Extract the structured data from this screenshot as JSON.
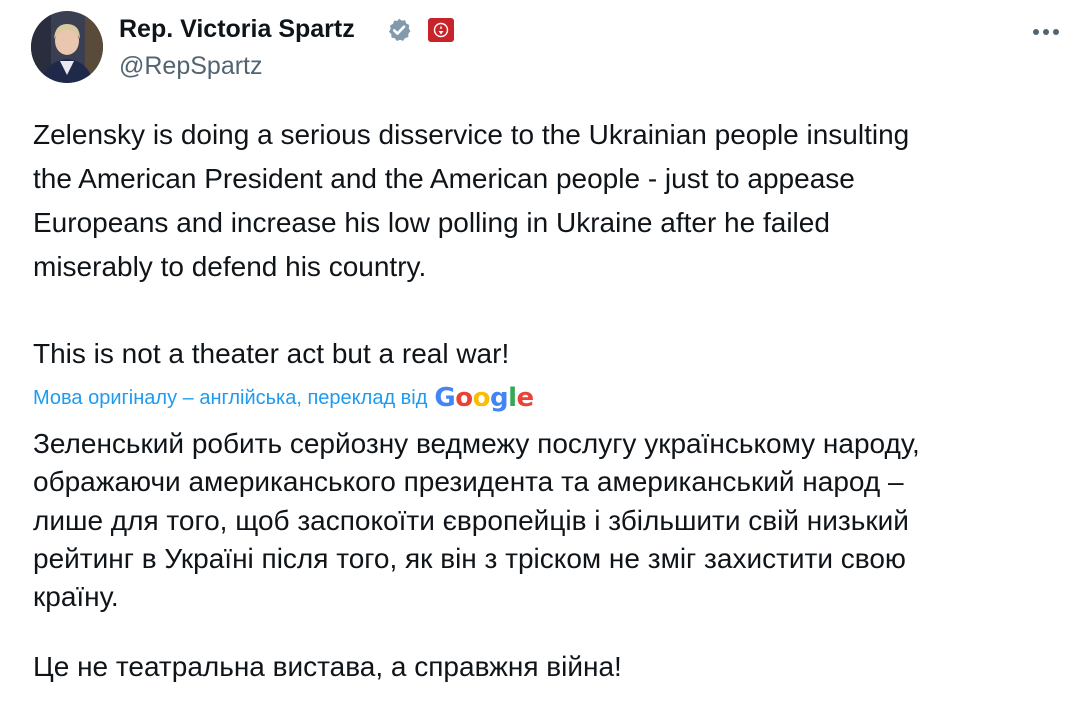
{
  "author": {
    "name": "Rep. Victoria Spartz",
    "handle": "@RepSpartz",
    "verified_icon": "verified-badge-icon",
    "affiliate_badge_icon": "congress-seal-icon",
    "colors": {
      "verified_badge": "#829aab",
      "affiliate_badge": "#c8222b"
    }
  },
  "post": {
    "original_lines": [
      "Zelensky is doing a serious disservice to the Ukrainian people insulting",
      "the American President and the American people - just to appease",
      "Europeans and increase his low polling in Ukraine after he failed",
      "miserably to defend his country.",
      "This is not a theater act but a real war!"
    ],
    "translation_label": "Мова оригіналу – англійська, переклад від",
    "translation_provider": "Google",
    "translated_lines": [
      "Зеленський робить серйозну ведмежу послугу українському народу,",
      "ображаючи американського президента та американський народ –",
      "лише для того, щоб заспокоїти європейців і збільшити свій низький",
      "рейтинг в Україні після того, як він з тріском не зміг захистити свою",
      "країну.",
      "Це не театральна вистава, а справжня війна!"
    ]
  },
  "icons": {
    "more": "more-options-icon"
  },
  "colors": {
    "text": "#0f1419",
    "secondary_text": "#536471",
    "link": "#1d9bf0",
    "google": [
      "#4285f4",
      "#ea4335",
      "#fbbc05",
      "#4285f4",
      "#34a853",
      "#ea4335"
    ]
  }
}
